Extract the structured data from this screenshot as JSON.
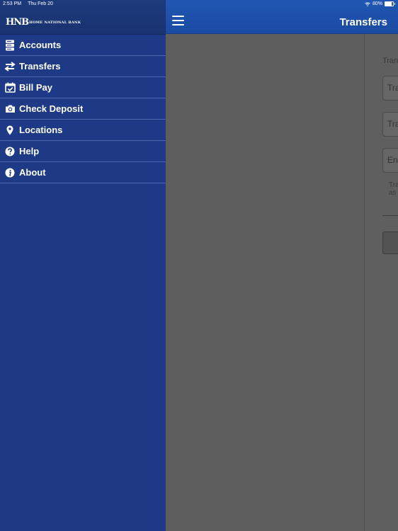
{
  "status_bar": {
    "time": "2:53 PM",
    "date": "Thu Feb 20",
    "battery": "80%",
    "battery_level": 0.8
  },
  "sidebar": {
    "logo_mark": "HNB",
    "logo_text": "HOME NATIONAL BANK",
    "items": [
      {
        "label": "Accounts",
        "icon": "accounts-icon"
      },
      {
        "label": "Transfers",
        "icon": "transfers-icon"
      },
      {
        "label": "Bill Pay",
        "icon": "calendar-check-icon"
      },
      {
        "label": "Check Deposit",
        "icon": "camera-icon"
      },
      {
        "label": "Locations",
        "icon": "map-pin-icon"
      },
      {
        "label": "Help",
        "icon": "question-icon"
      },
      {
        "label": "About",
        "icon": "info-icon"
      }
    ]
  },
  "header": {
    "title": "Transfers",
    "menu_icon": "hamburger-icon"
  },
  "content": {
    "section_label": "Tran",
    "field_from": "Tra",
    "field_to": "Tra",
    "field_amount": "En",
    "note_line1": "Tra",
    "note_line2": "as"
  },
  "colors": {
    "sidebar": "#1e3a86",
    "header": "#1f53ad",
    "overlay": "#5e5e5e"
  }
}
